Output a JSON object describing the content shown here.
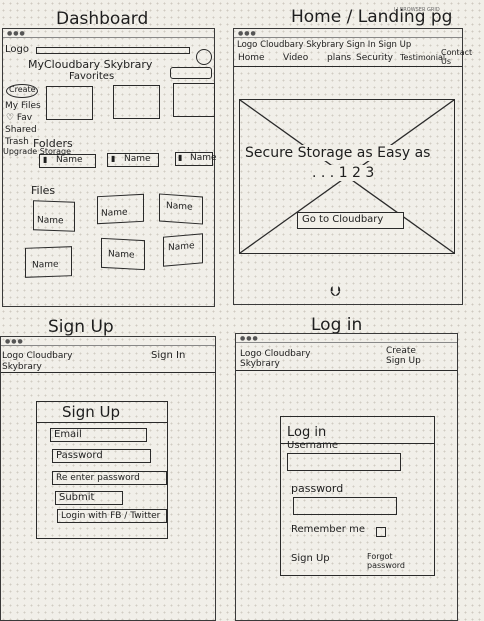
{
  "browser_grid": "LI BROWSER GRID",
  "dashboard": {
    "title": "Dashboard",
    "logo": "Logo",
    "my_cloudbary": "MyCloudbary Skybrary",
    "favorites": "Favorites",
    "sidebar": [
      "Create",
      "My Files",
      "♡ Fav",
      "Shared",
      "Trash",
      "Upgrade Storage"
    ],
    "folders_label": "Folders",
    "folder_items": [
      "Name",
      "Name",
      "Name"
    ],
    "files_label": "Files",
    "file_items": [
      "Name",
      "Name",
      "Name",
      "Name",
      "Name",
      "Name"
    ]
  },
  "home": {
    "title": "Home / Landing pg",
    "nav_top": "Logo Cloudbary Skybrary Sign In Sign Up",
    "nav_bottom": [
      "Home",
      "Video",
      "plans",
      "Security",
      "Testimonial",
      "Contact Us"
    ],
    "hero_title": "Secure Storage as Easy as",
    "hero_sub": ". . . 1 2 3",
    "cta_button": "Go to Cloudbary",
    "arrow": "⮋"
  },
  "signup": {
    "title": "Sign Up",
    "logo": "Logo Cloudbary Skybrary",
    "signin_link": "Sign In",
    "form_title": "Sign Up",
    "fields": [
      "Email",
      "Password",
      "Re enter password"
    ],
    "submit": "Submit",
    "social": "Login with FB / Twitter"
  },
  "login": {
    "title": "Log in",
    "logo": "Logo Cloudbary Skybrary",
    "create_link": "Create Sign Up",
    "form_title": "Log in",
    "username_label": "Username",
    "password_label": "password",
    "remember": "Remember me",
    "signup_link": "Sign Up",
    "forgot": "Forgot password"
  }
}
